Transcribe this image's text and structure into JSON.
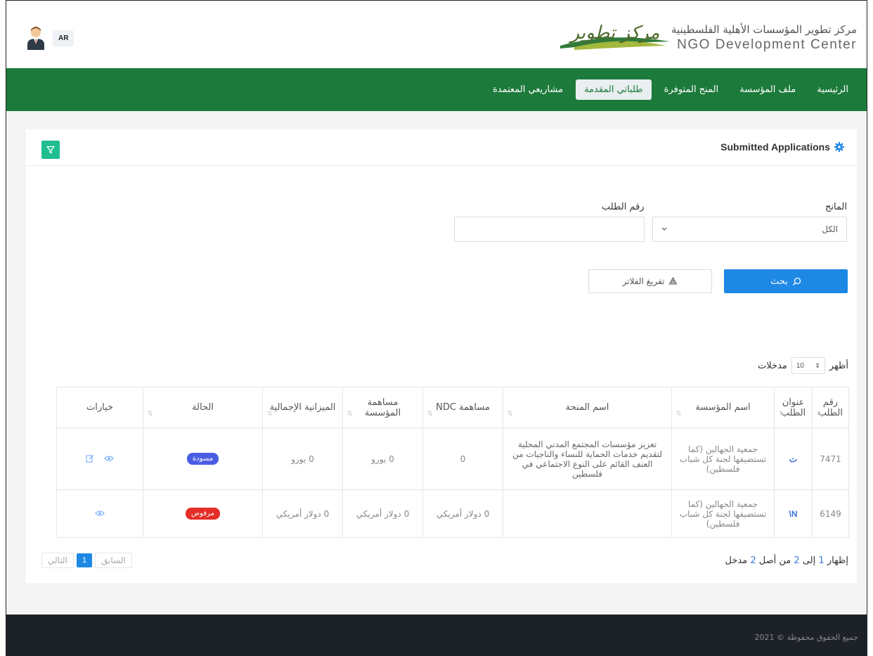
{
  "header": {
    "lang_button": "AR",
    "org_name_ar": "مركز تطوير المؤسسات الأهلية الفلسطينية",
    "org_name_en": "NGO Development Center",
    "logo_text": "مركز تطوير"
  },
  "nav": {
    "items": [
      {
        "label": "الرئيسية",
        "active": false
      },
      {
        "label": "ملف المؤسسة",
        "active": false
      },
      {
        "label": "المنح المتوفرة",
        "active": false
      },
      {
        "label": "طلباتي المقدمة",
        "active": true
      },
      {
        "label": "مشاريعي المعتمدة",
        "active": false
      }
    ]
  },
  "panel": {
    "title": "Submitted Applications",
    "filters": {
      "donor_label": "المانح",
      "donor_value": "الكل",
      "app_no_label": "رقم الطلب",
      "app_no_value": "",
      "search_button": "بحث",
      "clear_button": "تفريغ الفلاتر"
    },
    "entries": {
      "show_label": "أظهر",
      "value": "10",
      "suffix": "مدخلات"
    }
  },
  "table": {
    "headers": [
      "رقم الطلب",
      "عنوان الطلب",
      "اسم المؤسسة",
      "اسم المنحة",
      "مساهمة NDC",
      "مساهمة المؤسسة",
      "الميزانية الإجمالية",
      "الحالة",
      "خيارات"
    ],
    "rows": [
      {
        "app_no": "7471",
        "title": "ت",
        "org": "جمعية الجهالين (كما تستضيفها لجنة كل شباب فلسطين)",
        "grant": "تعزيز مؤسسات المجتمع المدني المحلية لتقديم خدمات الحماية للنساء والناجيات من العنف القائم على النوع الاجتماعي في فلسطين",
        "ndc": "0",
        "org_contrib": "0 يورو",
        "total": "0 يورو",
        "status": "مسودة",
        "status_color": "#4b5ce4"
      },
      {
        "app_no": "6149",
        "title": "N\\",
        "org": "جمعية الجهالين (كما تستضيفها لجنة كل شباب فلسطين)",
        "grant": "",
        "ndc": "0 دولار أمريكي",
        "org_contrib": "0 دولار أمريكي",
        "total": "0 دولار أمريكي",
        "status": "مرفوض",
        "status_color": "#e52d27"
      }
    ]
  },
  "info": {
    "prefix": "إظهار",
    "from": "1",
    "to_label": "إلى",
    "to": "2",
    "of_label": "من أصل",
    "total": "2",
    "suffix": "مدخل"
  },
  "pagination": {
    "prev": "السابق",
    "current": "1",
    "next": "التالي"
  },
  "footer": {
    "text": "جميع الحقوق محفوظة © 2021"
  },
  "colors": {
    "nav_green": "#1c7a3a",
    "primary_blue": "#1e88e5",
    "filter_teal": "#1fbd8f",
    "draft_badge": "#4b5ce4",
    "rejected_badge": "#e52d27"
  }
}
